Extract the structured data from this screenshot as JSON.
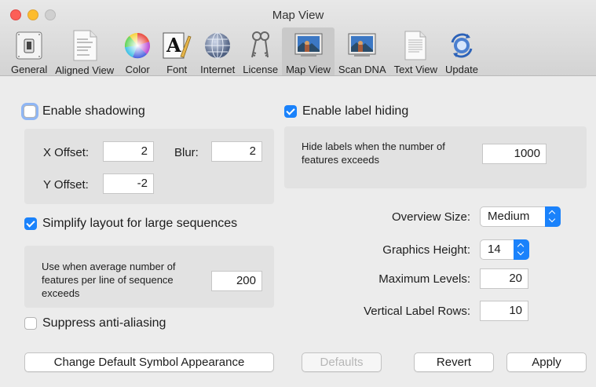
{
  "window": {
    "title": "Map View"
  },
  "toolbar": [
    {
      "key": "general",
      "label": "General",
      "icon": "switch-icon"
    },
    {
      "key": "aligned",
      "label": "Aligned View",
      "icon": "document-icon"
    },
    {
      "key": "color",
      "label": "Color",
      "icon": "color-wheel-icon"
    },
    {
      "key": "font",
      "label": "Font",
      "icon": "font-icon"
    },
    {
      "key": "internet",
      "label": "Internet",
      "icon": "globe-icon"
    },
    {
      "key": "license",
      "label": "License",
      "icon": "keys-icon"
    },
    {
      "key": "mapview",
      "label": "Map View",
      "icon": "picture-icon",
      "selected": true
    },
    {
      "key": "scandna",
      "label": "Scan DNA",
      "icon": "picture-icon"
    },
    {
      "key": "textview",
      "label": "Text View",
      "icon": "text-document-icon"
    },
    {
      "key": "update",
      "label": "Update",
      "icon": "sync-icon"
    }
  ],
  "shadowing": {
    "label": "Enable shadowing",
    "checked": false,
    "x_offset_label": "X Offset:",
    "x_offset": "2",
    "blur_label": "Blur:",
    "blur": "2",
    "y_offset_label": "Y Offset:",
    "y_offset": "-2"
  },
  "simplify": {
    "label": "Simplify layout for large sequences",
    "checked": true,
    "desc_line1": "Use when average number of",
    "desc_line2": "features per line of sequence",
    "desc_line3": "exceeds",
    "value": "200"
  },
  "suppress": {
    "label": "Suppress anti-aliasing",
    "checked": false
  },
  "label_hiding": {
    "label": "Enable label hiding",
    "checked": true,
    "desc_line1": "Hide labels when the number of",
    "desc_line2": "features exceeds",
    "value": "1000"
  },
  "settings": {
    "overview_label": "Overview Size:",
    "overview_value": "Medium",
    "graphics_label": "Graphics Height:",
    "graphics_value": "14",
    "max_levels_label": "Maximum Levels:",
    "max_levels_value": "20",
    "vlabel_label": "Vertical Label Rows:",
    "vlabel_value": "10"
  },
  "buttons": {
    "change_symbol": "Change Default Symbol Appearance",
    "defaults": "Defaults",
    "revert": "Revert",
    "apply": "Apply"
  },
  "colors": {
    "accent": "#1a82fb",
    "background": "#ececec",
    "group_box": "#e2e2e2"
  }
}
